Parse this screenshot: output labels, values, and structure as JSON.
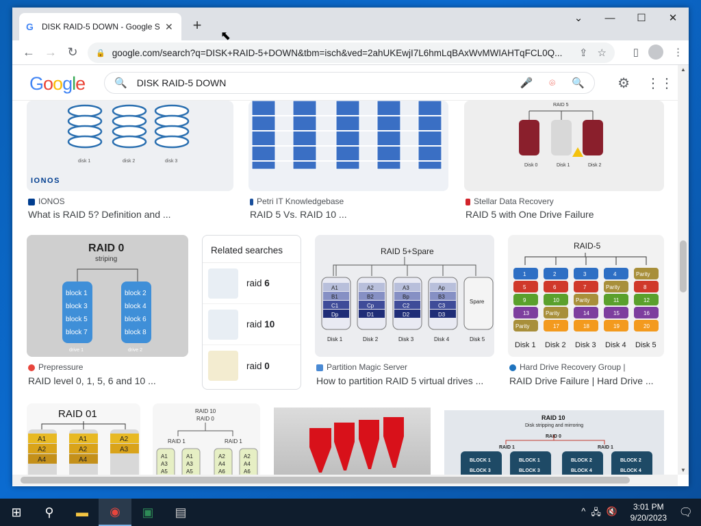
{
  "browser": {
    "tab_title": "DISK RAID-5 DOWN - Google Se",
    "url": "google.com/search?q=DISK+RAID-5+DOWN&tbm=isch&ved=2ahUKEwjI7L6hmLqBAxWvMWIAHTqFCL0Q..."
  },
  "search": {
    "query": "DISK RAID-5 DOWN"
  },
  "row1": [
    {
      "source": "IONOS",
      "caption": "What is RAID 5? Definition and ...",
      "fav_color": "#003d8f",
      "brand": "IONOS",
      "disk_labels": [
        "disk 1",
        "disk 2",
        "disk 3"
      ]
    },
    {
      "source": "Petri IT Knowledgebase",
      "caption": "RAID 5 Vs. RAID 10 ...",
      "fav_color": "#1a4f9c"
    },
    {
      "source": "Stellar Data Recovery",
      "caption": "RAID 5 with One Drive Failure",
      "fav_color": "#d2232a",
      "heading": "RAID 5",
      "disk_labels": [
        "Disk 0",
        "Disk 1",
        "Disk 2"
      ]
    }
  ],
  "row2": [
    {
      "source": "Prepressure",
      "caption": "RAID level 0, 1, 5, 6 and 10 ...",
      "fav_color": "#e8453c",
      "title": "RAID 0",
      "subtitle": "striping",
      "drive1": [
        "block 1",
        "block 3",
        "block 5",
        "block 7"
      ],
      "drive2": [
        "block 2",
        "block 4",
        "block 6",
        "block 8"
      ],
      "drive_labels": [
        "drive 1",
        "drive 2"
      ]
    },
    {
      "source": "Partition Magic Server",
      "caption": "How to partition RAID 5 virtual drives ...",
      "fav_color": "#4a8ad4",
      "title": "RAID 5+Spare",
      "disks": [
        {
          "label": "Disk 1",
          "cells": [
            "A1",
            "B1",
            "C1",
            "Dp"
          ]
        },
        {
          "label": "Disk 2",
          "cells": [
            "A2",
            "B2",
            "Cp",
            "D1"
          ]
        },
        {
          "label": "Disk 3",
          "cells": [
            "A3",
            "Bp",
            "C2",
            "D2"
          ]
        },
        {
          "label": "Disk 4",
          "cells": [
            "Ap",
            "B3",
            "C3",
            "D3"
          ]
        },
        {
          "label": "Disk 5",
          "cells": [
            "Spare"
          ]
        }
      ]
    },
    {
      "source": "Hard Drive Recovery Group |",
      "caption": "RAID Drive Failure | Hard Drive ...",
      "fav_color": "#1e73be",
      "title": "RAID-5",
      "disks": [
        {
          "label": "Disk 1",
          "cells": [
            "1",
            "5",
            "9",
            "13",
            "Parity"
          ]
        },
        {
          "label": "Disk 2",
          "cells": [
            "2",
            "6",
            "10",
            "Parity",
            "17"
          ]
        },
        {
          "label": "Disk 3",
          "cells": [
            "3",
            "7",
            "Parity",
            "14",
            "18"
          ]
        },
        {
          "label": "Disk 4",
          "cells": [
            "4",
            "Parity",
            "11",
            "15",
            "19"
          ]
        },
        {
          "label": "Disk 5",
          "cells": [
            "Parity",
            "8",
            "12",
            "16",
            "20"
          ]
        }
      ]
    }
  ],
  "related": {
    "title": "Related searches",
    "items": [
      {
        "prefix": "raid ",
        "bold": "6"
      },
      {
        "prefix": "raid ",
        "bold": "10"
      },
      {
        "prefix": "raid ",
        "bold": "0"
      }
    ]
  },
  "row3": [
    {
      "title": "RAID 01",
      "cells": [
        [
          "A1",
          "A2",
          "A4"
        ],
        [
          "A1",
          "A2",
          "A4"
        ],
        [
          "A2",
          "A3"
        ]
      ]
    },
    {
      "title": "RAID 10",
      "sub": "RAID 0",
      "groups": [
        "RAID 1",
        "RAID 1"
      ],
      "cells": [
        [
          "A1",
          "A3",
          "A5"
        ],
        [
          "A1",
          "A3",
          "A5"
        ],
        [
          "A2",
          "A4",
          "A6"
        ],
        [
          "A2",
          "A4",
          "A6"
        ]
      ]
    },
    {
      "kind": "photo"
    },
    {
      "title": "RAID 10",
      "subtitle": "Disk stripping and mirroring",
      "sub": "RAID 0",
      "groups": [
        "RAID 1",
        "RAID 1"
      ],
      "cells": [
        [
          "BLOCK 1",
          "BLOCK 3"
        ],
        [
          "BLOCK 1",
          "BLOCK 3"
        ],
        [
          "BLOCK 2",
          "BLOCK 4"
        ],
        [
          "BLOCK 2",
          "BLOCK 4"
        ]
      ]
    }
  ],
  "taskbar": {
    "time": "3:01 PM",
    "date": "9/20/2023"
  },
  "colors": {
    "accent": "#4285f4",
    "taskbar": "#0f1d2d"
  }
}
